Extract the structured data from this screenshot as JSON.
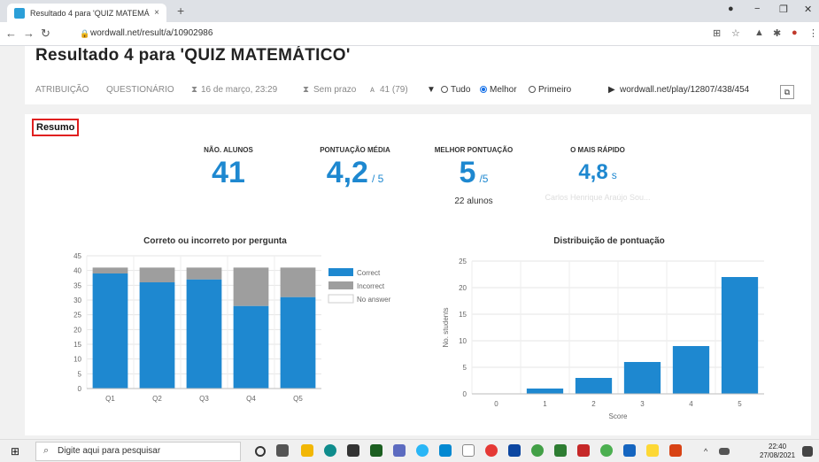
{
  "browser": {
    "tab_title": "Resultado 4 para 'QUIZ MATEMÁ",
    "tab_close": "×",
    "new_tab": "+",
    "url": "wordwall.net/result/a/10902986",
    "minimize": "−",
    "maximize": "❐",
    "close": "✕"
  },
  "header": {
    "title": "Resultado 4 para 'QUIZ MATEMÁTICO'",
    "atribuicao": "ATRIBUIÇÃO",
    "questionario": "QUESTIONÁRIO",
    "date": "16 de março, 23:29",
    "deadline": "Sem prazo",
    "participants": "41 (79)",
    "filter_all": "Tudo",
    "filter_best": "Melhor",
    "filter_first": "Primeiro",
    "play_link": "wordwall.net/play/12807/438/454"
  },
  "summary": {
    "label": "Resumo",
    "stats": [
      {
        "label": "NÃO. ALUNOS",
        "value": "41",
        "unit": "",
        "sub": ""
      },
      {
        "label": "PONTUAÇÃO MÉDIA",
        "value": "4,2",
        "unit": "/ 5",
        "sub": ""
      },
      {
        "label": "MELHOR PONTUAÇÃO",
        "value": "5",
        "unit": "/5",
        "sub": "22 alunos"
      },
      {
        "label": "O MAIS RÁPIDO",
        "value": "4,8",
        "unit": "s",
        "sub": "Carlos Henrique Araújo Sou..."
      }
    ]
  },
  "colors": {
    "correct": "#1e88d0",
    "incorrect": "#9e9e9e",
    "accent": "#1a73e8"
  },
  "chart_data": [
    {
      "type": "bar",
      "title": "Correto ou incorreto por pergunta",
      "categories": [
        "Q1",
        "Q2",
        "Q3",
        "Q4",
        "Q5"
      ],
      "series": [
        {
          "name": "Correct",
          "values": [
            39,
            36,
            37,
            28,
            31
          ]
        },
        {
          "name": "Incorrect",
          "values": [
            2,
            5,
            4,
            13,
            10
          ]
        },
        {
          "name": "No answer",
          "values": [
            0,
            0,
            0,
            0,
            0
          ]
        }
      ],
      "stacked": true,
      "ylim": [
        0,
        45
      ],
      "yticks": [
        0,
        5,
        10,
        15,
        20,
        25,
        30,
        35,
        40,
        45
      ],
      "legend": "right"
    },
    {
      "type": "bar",
      "title": "Distribuição de pontuação",
      "categories": [
        "0",
        "1",
        "2",
        "3",
        "4",
        "5"
      ],
      "values": [
        0,
        1,
        3,
        6,
        9,
        22
      ],
      "xlabel": "Score",
      "ylabel": "No. students",
      "ylim": [
        0,
        25
      ],
      "yticks": [
        0,
        5,
        10,
        15,
        20,
        25
      ]
    }
  ],
  "taskbar": {
    "search_placeholder": "Digite aqui para pesquisar",
    "time": "22:40",
    "date": "27/08/2021"
  }
}
